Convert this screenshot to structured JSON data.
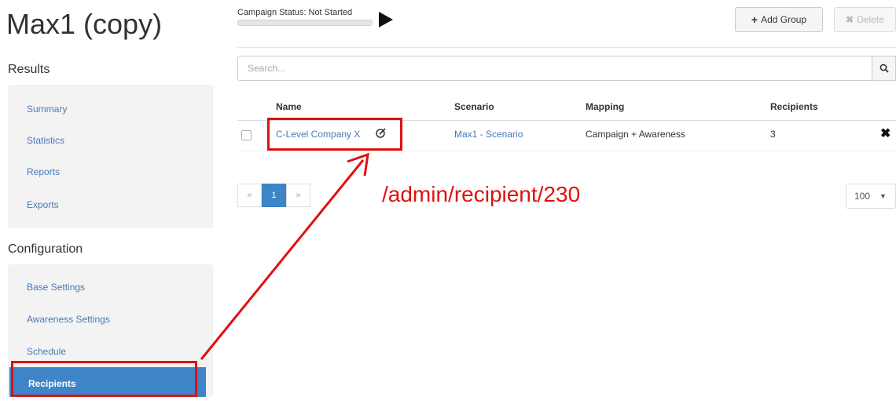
{
  "page": {
    "title": "Max1 (copy)"
  },
  "campaign": {
    "status_label": "Campaign Status:",
    "status_value": "Not Started"
  },
  "toolbar": {
    "add_group_label": "Add Group",
    "delete_label": "Delete"
  },
  "sidebar": {
    "results_heading": "Results",
    "results_items": [
      {
        "label": "Summary"
      },
      {
        "label": "Statistics"
      },
      {
        "label": "Reports"
      },
      {
        "label": "Exports"
      }
    ],
    "configuration_heading": "Configuration",
    "configuration_items": [
      {
        "label": "Base Settings"
      },
      {
        "label": "Awareness Settings"
      },
      {
        "label": "Schedule"
      },
      {
        "label": "Recipients",
        "active": true
      }
    ]
  },
  "search": {
    "placeholder": "Search..."
  },
  "table": {
    "headers": {
      "name": "Name",
      "scenario": "Scenario",
      "mapping": "Mapping",
      "recipients": "Recipients"
    },
    "rows": [
      {
        "name": "C-Level Company X",
        "scenario": "Max1 - Scenario",
        "mapping": "Campaign + Awareness",
        "recipients": "3"
      }
    ]
  },
  "pagination": {
    "prev": "«",
    "current": "1",
    "next": "»",
    "per_page": "100"
  },
  "annotation": {
    "text": "/admin/recipient/230"
  },
  "colors": {
    "accent": "#3e85c8",
    "link": "#4a7ab5",
    "highlight": "#e01010"
  },
  "icons": {
    "play": "play-icon",
    "add": "plus-icon",
    "delete": "close-icon",
    "search": "search-icon",
    "edit": "edit-icon",
    "remove": "close-icon",
    "dropdown": "caret-down-icon"
  }
}
